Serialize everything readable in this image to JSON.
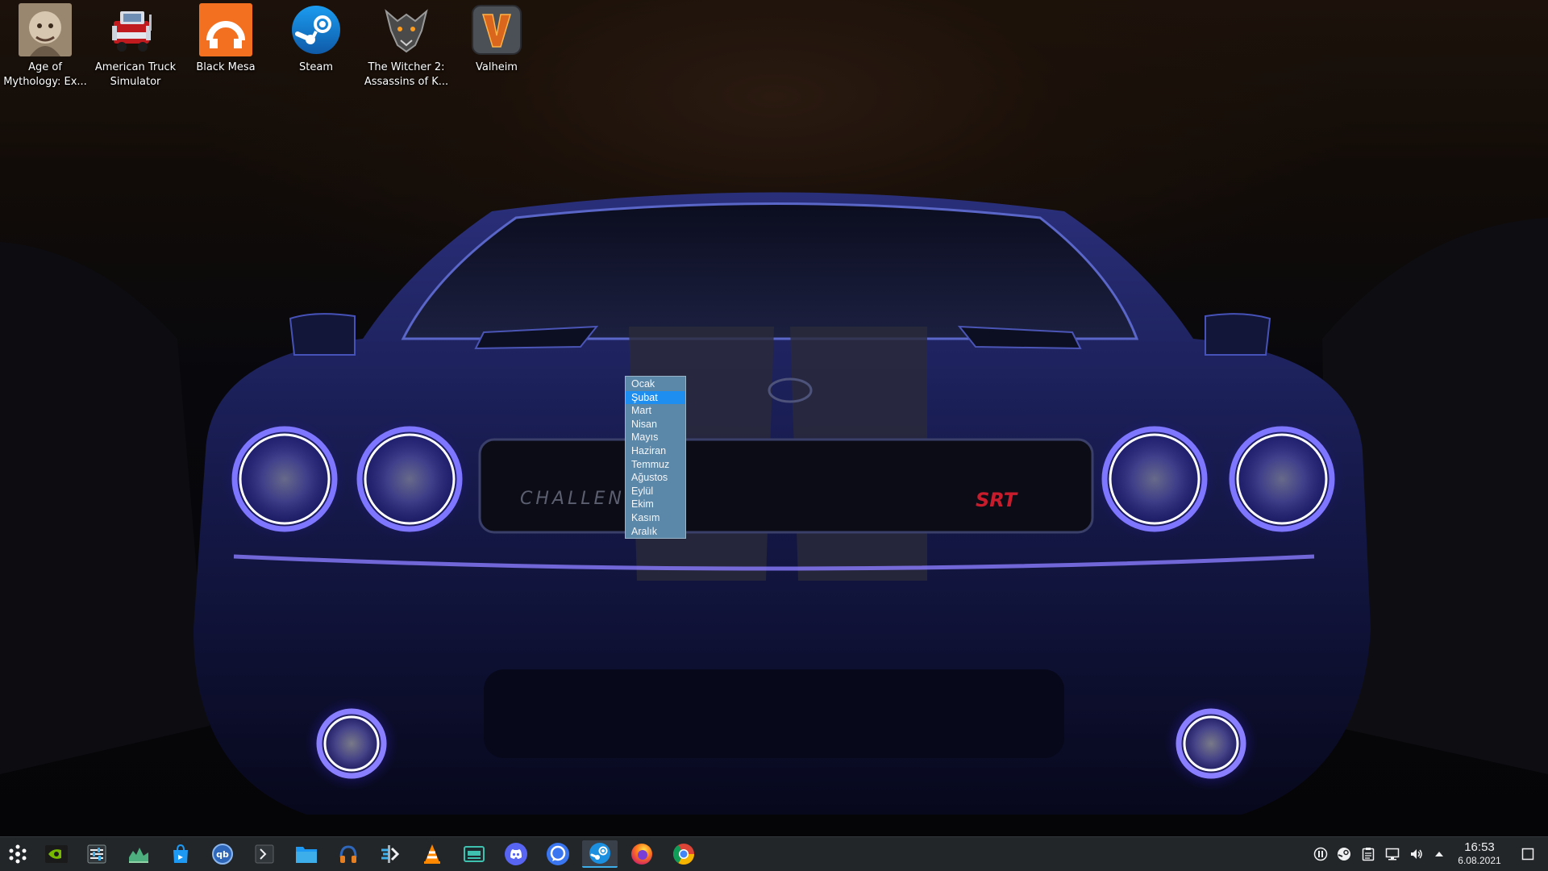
{
  "desktop": {
    "icons": [
      {
        "label": "Age of\nMythology: Ex...",
        "icon": "age-of-mythology-icon"
      },
      {
        "label": "American Truck\nSimulator",
        "icon": "truck-icon"
      },
      {
        "label": "Black Mesa",
        "icon": "black-mesa-icon"
      },
      {
        "label": "Steam",
        "icon": "steam-icon"
      },
      {
        "label": "The Witcher 2:\nAssassins of K...",
        "icon": "witcher-wolf-icon"
      },
      {
        "label": "Valheim",
        "icon": "valheim-icon"
      }
    ]
  },
  "month_dropdown": {
    "items": [
      "Ocak",
      "Şubat",
      "Mart",
      "Nisan",
      "Mayıs",
      "Haziran",
      "Temmuz",
      "Ağustos",
      "Eylül",
      "Ekim",
      "Kasım",
      "Aralık"
    ],
    "selected": "Şubat"
  },
  "taskbar": {
    "apps": [
      {
        "icon": "app-launcher-icon"
      },
      {
        "icon": "nvidia-icon"
      },
      {
        "icon": "system-settings-icon"
      },
      {
        "icon": "system-monitor-icon"
      },
      {
        "icon": "discover-store-icon"
      },
      {
        "icon": "qbittorrent-icon"
      },
      {
        "icon": "terminal-icon"
      },
      {
        "icon": "file-manager-icon"
      },
      {
        "icon": "audio-player-icon"
      },
      {
        "icon": "kde-connect-icon"
      },
      {
        "icon": "vlc-icon"
      },
      {
        "icon": "virtual-machine-icon"
      },
      {
        "icon": "discord-icon"
      },
      {
        "icon": "signal-icon"
      },
      {
        "icon": "steam-icon"
      },
      {
        "icon": "firefox-icon"
      },
      {
        "icon": "chrome-icon"
      }
    ],
    "tray": [
      {
        "icon": "media-pause-icon"
      },
      {
        "icon": "steam-tray-icon"
      },
      {
        "icon": "clipboard-icon"
      },
      {
        "icon": "network-icon"
      },
      {
        "icon": "volume-icon"
      },
      {
        "icon": "expand-tray-icon"
      }
    ],
    "clock": {
      "time": "16:53",
      "date": "6.08.2021"
    }
  },
  "colors": {
    "taskbar_bg": "#232629",
    "dropdown_bg": "#5b87a8",
    "dropdown_selected": "#1e8ef0",
    "accent": "#3daee9",
    "headlight_glow": "#5a4dff"
  }
}
